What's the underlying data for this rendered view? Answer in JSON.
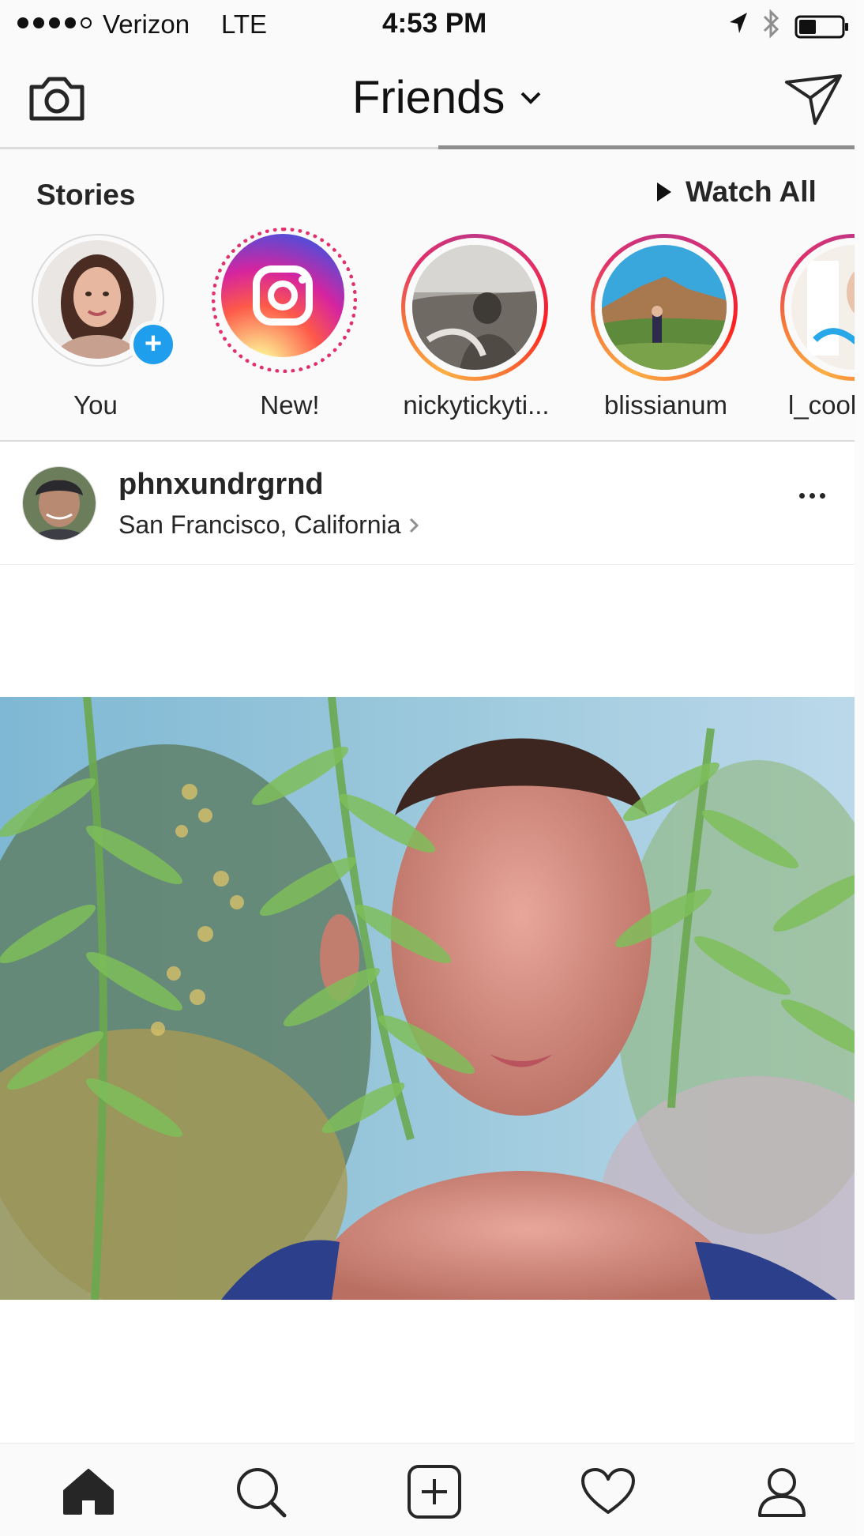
{
  "status_bar": {
    "carrier": "Verizon",
    "network": "LTE",
    "time": "4:53 PM",
    "signal_bars": 4,
    "signal_total": 5,
    "battery_level": 0.4
  },
  "header": {
    "title": "Friends",
    "camera_icon": "camera-icon",
    "dropdown_icon": "chevron-down-icon",
    "send_icon": "paper-plane-icon"
  },
  "stories": {
    "label": "Stories",
    "watch_all_label": "Watch All",
    "items": [
      {
        "name": "You"
      },
      {
        "name": "New!"
      },
      {
        "name": "nickytickyti..."
      },
      {
        "name": "blissianum"
      },
      {
        "name": "l_cool"
      }
    ]
  },
  "post": {
    "username": "phnxundrgrnd",
    "location": "San Francisco, California"
  },
  "tab_bar": {
    "items": [
      {
        "icon": "home-icon",
        "active": true
      },
      {
        "icon": "search-icon",
        "active": false
      },
      {
        "icon": "add-post-icon",
        "active": false
      },
      {
        "icon": "heart-icon",
        "active": false
      },
      {
        "icon": "profile-icon",
        "active": false
      }
    ]
  },
  "colors": {
    "story_ring_gradient": [
      "#c13584",
      "#e1306c",
      "#fd1d1d",
      "#f77737",
      "#fcaf45"
    ],
    "add_badge": "#1e9eec",
    "text_primary": "#262626",
    "bar_background": "#fafafa"
  }
}
